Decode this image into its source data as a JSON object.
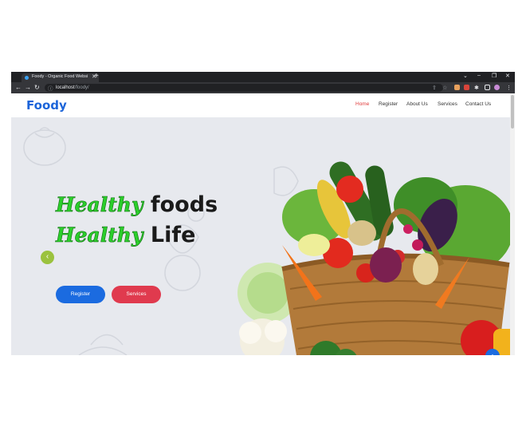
{
  "browser": {
    "tab_title": "Foody - Organic Food Website Te",
    "tab_close": "✕",
    "new_tab": "+",
    "url_host": "localhost",
    "url_path": "/foody/",
    "window_controls": [
      "⌄",
      "–",
      "❐",
      "✕"
    ]
  },
  "site": {
    "logo": "Foody",
    "menu": [
      "Home",
      "Register",
      "About Us",
      "Services",
      "Contact Us"
    ],
    "hero": {
      "line1_script": "Healthy",
      "line1_word": "foods",
      "line2_script": "Healthy",
      "line2_word": "Life",
      "buttons": [
        "Register",
        "Services"
      ]
    },
    "back_to_top": "↑",
    "carousel_prev": "‹"
  },
  "colors": {
    "brand_blue": "#1c64d9",
    "active_red": "#e03b3b",
    "btn_register": "#1b6be0",
    "btn_services": "#e03a4e",
    "script_green": "#2bcf2b"
  }
}
